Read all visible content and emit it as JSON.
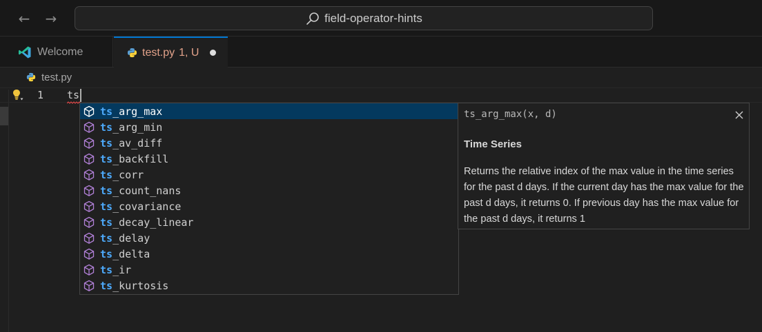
{
  "titlebar": {
    "search_text": "field-operator-hints"
  },
  "tabs": [
    {
      "label": "Welcome",
      "icon": "vscode-icon"
    },
    {
      "label": "test.py",
      "badge": "1, U",
      "icon": "python-icon",
      "dirty": true
    }
  ],
  "breadcrumb": {
    "file": "test.py"
  },
  "editor": {
    "line_number": "1",
    "code": "ts"
  },
  "suggestions": {
    "prefix": "ts",
    "items": [
      "_arg_max",
      "_arg_min",
      "_av_diff",
      "_backfill",
      "_corr",
      "_count_nans",
      "_covariance",
      "_decay_linear",
      "_delay",
      "_delta",
      "_ir",
      "_kurtosis"
    ],
    "selected_index": 0
  },
  "details": {
    "signature": "ts_arg_max(x, d)",
    "title": "Time Series",
    "body": "Returns the relative index of the max value in the time series for the past d days. If the current day has the max value for the past d days, it returns 0. If previous day has the max value for the past d days, it returns 1"
  },
  "colors": {
    "accent": "#0078d4",
    "selection": "#04395e",
    "match_highlight": "#4daafc",
    "symbol_icon": "#b180d7",
    "modified_tab": "#e2a28a"
  }
}
